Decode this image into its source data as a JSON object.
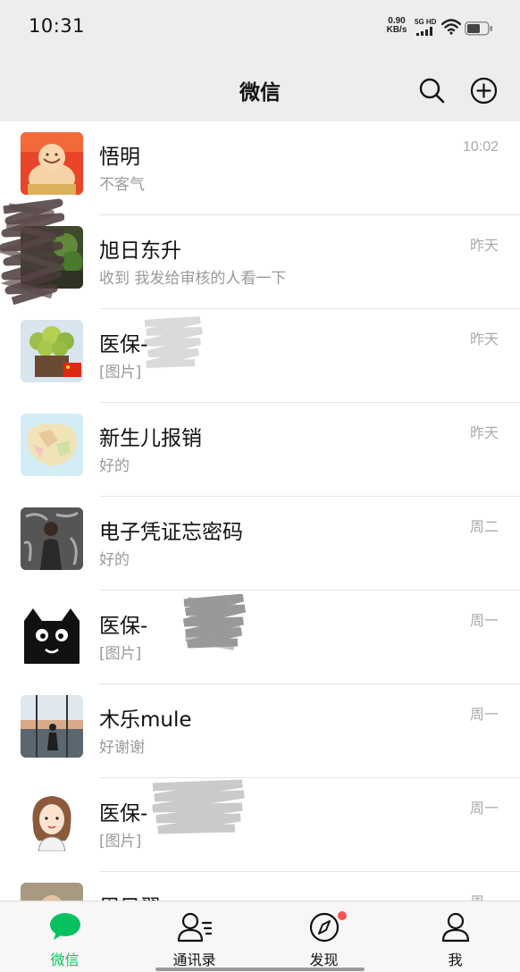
{
  "status_bar": {
    "time": "10:31",
    "net_speed_value": "0.90",
    "net_speed_unit": "KB/s",
    "network_label": "5G HD"
  },
  "header": {
    "title": "微信"
  },
  "chats": [
    {
      "name": "悟明",
      "preview": "不客气",
      "time": "10:02",
      "avatar": "buddha-statue"
    },
    {
      "name": "旭日东升",
      "preview": "收到 我发给审核的人看一下",
      "time": "昨天",
      "avatar": "green-plants-redacted"
    },
    {
      "name": "医保-",
      "preview": "[图片]",
      "time": "昨天",
      "avatar": "potted-plant-flag"
    },
    {
      "name": "新生儿报销",
      "preview": "好的",
      "time": "昨天",
      "avatar": "map"
    },
    {
      "name": "电子凭证忘密码",
      "preview": "好的",
      "time": "周二",
      "avatar": "person-photo"
    },
    {
      "name": "医保-",
      "preview": "[图片]",
      "time": "周一",
      "avatar": "black-cat-cartoon"
    },
    {
      "name": "木乐mule",
      "preview": "好谢谢",
      "time": "周一",
      "avatar": "person-by-window"
    },
    {
      "name": "医保-",
      "preview": "[图片]",
      "time": "周一",
      "avatar": "cartoon-woman"
    },
    {
      "name": "周目翠",
      "preview": "",
      "time": "周一",
      "avatar": "portrait"
    }
  ],
  "tabs": [
    {
      "label": "微信",
      "icon": "chat-bubble-icon",
      "active": true
    },
    {
      "label": "通讯录",
      "icon": "contacts-icon",
      "active": false
    },
    {
      "label": "发现",
      "icon": "compass-icon",
      "active": false,
      "has_badge": true
    },
    {
      "label": "我",
      "icon": "person-icon",
      "active": false
    }
  ],
  "colors": {
    "accent": "#07c160",
    "background": "#ededed",
    "badge": "#fa5151"
  }
}
